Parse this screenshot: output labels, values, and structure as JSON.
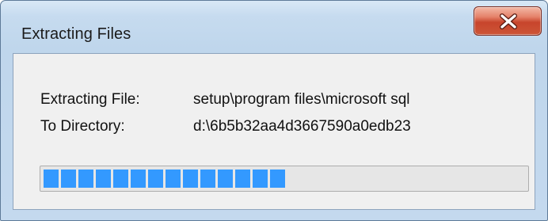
{
  "window": {
    "title": "Extracting Files"
  },
  "labels": {
    "file_label": "Extracting File:",
    "file_value": "setup\\program files\\microsoft sql",
    "dir_label": "To Directory:",
    "dir_value": "d:\\6b5b32aa4d3667590a0edb23"
  },
  "progress": {
    "fraction": 0.52,
    "segments_filled": 14,
    "color": "#3399ff"
  },
  "icons": {
    "close": "close-icon"
  }
}
